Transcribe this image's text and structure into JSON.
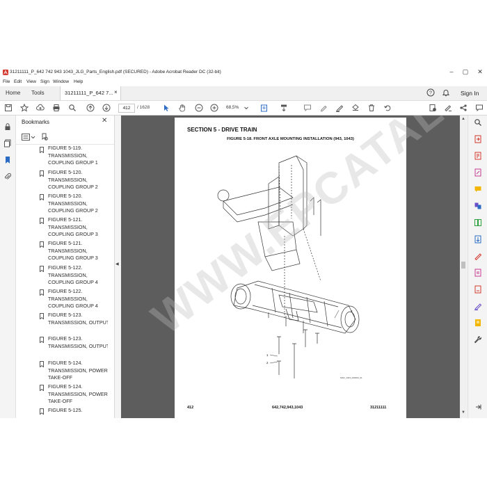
{
  "window": {
    "title": "31211111_P_642 742 943 1043_JLG_Parts_English.pdf (SECURED) - Adobe Acrobat Reader DC (32-bit)",
    "controls": [
      "–",
      "▢",
      "✕"
    ]
  },
  "menu": [
    "File",
    "Edit",
    "View",
    "Sign",
    "Window",
    "Help"
  ],
  "tabs": {
    "home": "Home",
    "tools": "Tools",
    "document": "31211111_P_642 7...",
    "close": "×",
    "sign_in": "Sign In"
  },
  "toolbar": {
    "page_current": "412",
    "page_total": "/ 1628",
    "zoom": "68,5%"
  },
  "bookmarks": {
    "title": "Bookmarks",
    "close": "✕",
    "items": [
      "FIGURE 5-119. TRANSMISSION, COUPLING GROUP 1",
      "FIGURE 5-120. TRANSMISSION, COUPLING GROUP 2",
      "FIGURE 5-120. TRANSMISSION, COUPLING GROUP 2",
      "FIGURE 5-121. TRANSMISSION, COUPLING GROUP 3",
      "FIGURE 5-121. TRANSMISSION, COUPLING GROUP 3",
      "FIGURE 5-122. TRANSMISSION, COUPLING GROUP 4",
      "FIGURE 5-122. TRANSMISSION, COUPLING GROUP 4",
      "FIGURE 5-123. TRANSMISSION, OUTPUT",
      "FIGURE 5-123. TRANSMISSION, OUTPUT",
      "FIGURE 5-124. TRANSMISSION, POWER TAKE-OFF",
      "FIGURE 5-124. TRANSMISSION, POWER TAKE-OFF",
      "FIGURE 5-125."
    ]
  },
  "page": {
    "section": "SECTION 5 - DRIVE TRAIN",
    "figure": "FIGURE 5-18. FRONT AXLE MOUNTING INSTALLATION (943, 1043)",
    "callouts": [
      "1",
      "2",
      "3"
    ],
    "drawing_code": "MAN_1043_000063_01",
    "footer_left": "412",
    "footer_center": "642,742,943,1043",
    "footer_right": "31211111"
  },
  "watermark": "WWW.EPCATALOGS.COM",
  "colors": {
    "acrobat_red": "#d4372c",
    "acrobat_blue": "#2b6bc4",
    "canvas_gray": "#5d5d5d"
  }
}
